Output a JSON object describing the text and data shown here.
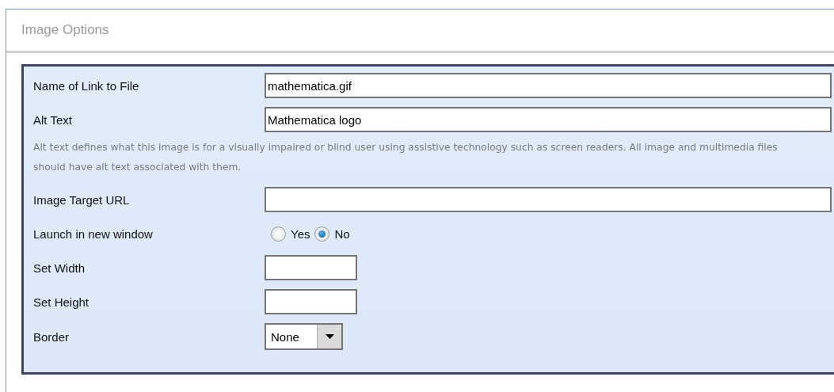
{
  "panel": {
    "title": "Image Options"
  },
  "rows": [
    {
      "kind": "text",
      "label": "Name of Link to File",
      "value": "mathematica.gif"
    },
    {
      "kind": "text",
      "label": "Alt Text",
      "value": "Mathematica logo"
    },
    {
      "kind": "help",
      "text": "Alt text defines what this image is for a visually impaired or blind user using assistive technology such as screen readers. All image and multimedia files should have alt text associated with them."
    },
    {
      "kind": "text",
      "label": "Image Target URL"
    },
    {
      "kind": "radio",
      "label": "Launch in new window",
      "options": [
        {
          "label": "Yes",
          "selected": false
        },
        {
          "label": "No",
          "selected": true
        }
      ]
    },
    {
      "kind": "number",
      "label": "Set Width"
    },
    {
      "kind": "number",
      "label": "Set Height"
    },
    {
      "kind": "select",
      "label": "Border",
      "value": "None"
    }
  ]
}
